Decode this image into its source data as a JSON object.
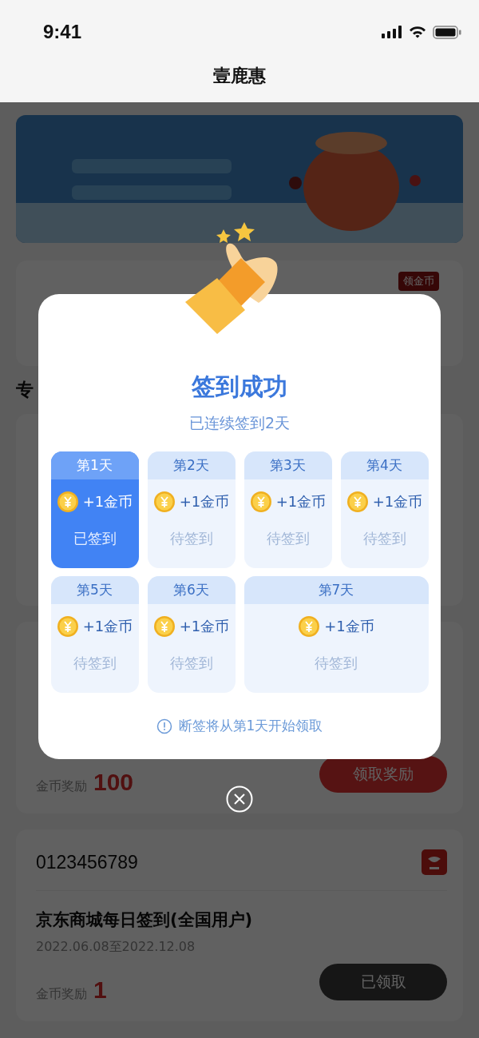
{
  "status_bar": {
    "time": "9:41"
  },
  "header": {
    "title": "壹鹿惠"
  },
  "page": {
    "badge": "领金币",
    "section_title": "专",
    "tasks": [
      {
        "reward_label": "金币奖励",
        "reward": "100",
        "button": "领取奖励",
        "claimed": false
      },
      {
        "account": "0123456789",
        "title": "京东商城每日签到(全国用户)",
        "period": "2022.06.08至2022.12.08",
        "reward_label": "金币奖励",
        "reward": "1",
        "button": "已领取",
        "claimed": true
      }
    ]
  },
  "dialog": {
    "title": "签到成功",
    "subtitle": "已连续签到2天",
    "days": [
      {
        "label": "第1天",
        "reward": "+1金币",
        "status": "已签到",
        "signed": true
      },
      {
        "label": "第2天",
        "reward": "+1金币",
        "status": "待签到",
        "signed": false
      },
      {
        "label": "第3天",
        "reward": "+1金币",
        "status": "待签到",
        "signed": false
      },
      {
        "label": "第4天",
        "reward": "+1金币",
        "status": "待签到",
        "signed": false
      },
      {
        "label": "第5天",
        "reward": "+1金币",
        "status": "待签到",
        "signed": false
      },
      {
        "label": "第6天",
        "reward": "+1金币",
        "status": "待签到",
        "signed": false
      },
      {
        "label": "第7天",
        "reward": "+1金币",
        "status": "待签到",
        "signed": false
      }
    ],
    "notice": "断签将从第1天开始领取"
  }
}
